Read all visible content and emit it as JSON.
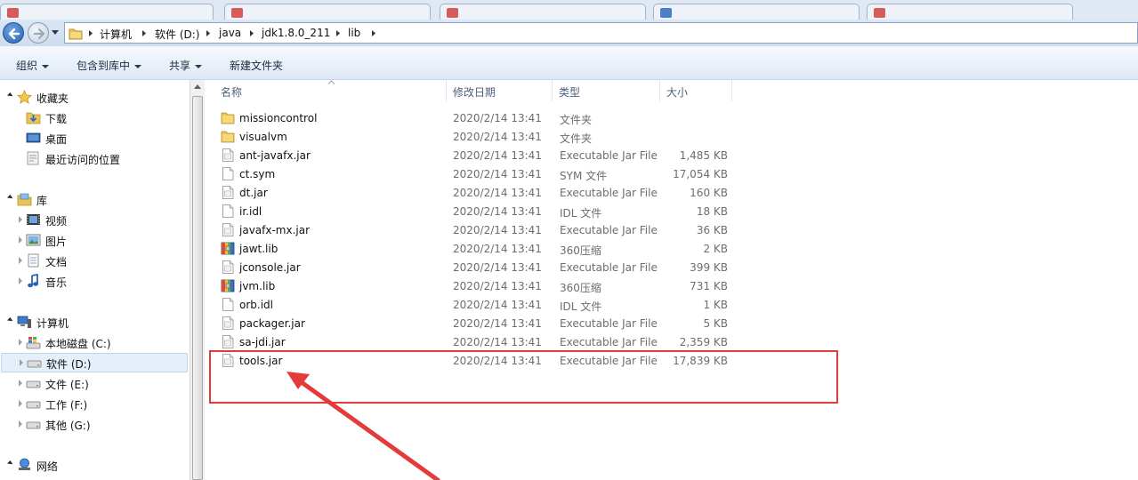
{
  "browser_tabs": [
    {
      "label": "",
      "color": "#d85b5b"
    },
    {
      "label": "",
      "color": "#d85b5b"
    },
    {
      "label": "",
      "color": "#d85b5b"
    },
    {
      "label": "",
      "color": "#4b7fc7"
    },
    {
      "label": "",
      "color": "#d85b5b"
    }
  ],
  "address_bar": {
    "breadcrumbs": [
      "计算机",
      "软件 (D:)",
      "java",
      "jdk1.8.0_211",
      "lib"
    ]
  },
  "toolbar": {
    "organize": "组织",
    "include_in_library": "包含到库中",
    "share": "共享",
    "new_folder": "新建文件夹"
  },
  "nav": {
    "favorites": {
      "label": "收藏夹",
      "items": [
        "下载",
        "桌面",
        "最近访问的位置"
      ]
    },
    "libraries": {
      "label": "库",
      "items": [
        "视频",
        "图片",
        "文档",
        "音乐"
      ]
    },
    "computer": {
      "label": "计算机",
      "items": [
        "本地磁盘 (C:)",
        "软件 (D:)",
        "文件 (E:)",
        "工作 (F:)",
        "其他 (G:)"
      ],
      "selected": "软件 (D:)"
    },
    "network": {
      "label": "网络"
    }
  },
  "columns": {
    "name": "名称",
    "date": "修改日期",
    "type": "类型",
    "size": "大小"
  },
  "files": [
    {
      "name": "missioncontrol",
      "date": "2020/2/14 13:41",
      "type": "文件夹",
      "size": "",
      "icon": "folder-icon"
    },
    {
      "name": "visualvm",
      "date": "2020/2/14 13:41",
      "type": "文件夹",
      "size": "",
      "icon": "folder-icon"
    },
    {
      "name": "ant-javafx.jar",
      "date": "2020/2/14 13:41",
      "type": "Executable Jar File",
      "size": "1,485 KB",
      "icon": "jar-file-icon"
    },
    {
      "name": "ct.sym",
      "date": "2020/2/14 13:41",
      "type": "SYM 文件",
      "size": "17,054 KB",
      "icon": "generic-file-icon"
    },
    {
      "name": "dt.jar",
      "date": "2020/2/14 13:41",
      "type": "Executable Jar File",
      "size": "160 KB",
      "icon": "jar-file-icon"
    },
    {
      "name": "ir.idl",
      "date": "2020/2/14 13:41",
      "type": "IDL 文件",
      "size": "18 KB",
      "icon": "generic-file-icon"
    },
    {
      "name": "javafx-mx.jar",
      "date": "2020/2/14 13:41",
      "type": "Executable Jar File",
      "size": "36 KB",
      "icon": "jar-file-icon"
    },
    {
      "name": "jawt.lib",
      "date": "2020/2/14 13:41",
      "type": "360压缩",
      "size": "2 KB",
      "icon": "archive-icon"
    },
    {
      "name": "jconsole.jar",
      "date": "2020/2/14 13:41",
      "type": "Executable Jar File",
      "size": "399 KB",
      "icon": "jar-file-icon"
    },
    {
      "name": "jvm.lib",
      "date": "2020/2/14 13:41",
      "type": "360压缩",
      "size": "731 KB",
      "icon": "archive-icon"
    },
    {
      "name": "orb.idl",
      "date": "2020/2/14 13:41",
      "type": "IDL 文件",
      "size": "1 KB",
      "icon": "generic-file-icon"
    },
    {
      "name": "packager.jar",
      "date": "2020/2/14 13:41",
      "type": "Executable Jar File",
      "size": "5 KB",
      "icon": "jar-file-icon"
    },
    {
      "name": "sa-jdi.jar",
      "date": "2020/2/14 13:41",
      "type": "Executable Jar File",
      "size": "2,359 KB",
      "icon": "jar-file-icon"
    },
    {
      "name": "tools.jar",
      "date": "2020/2/14 13:41",
      "type": "Executable Jar File",
      "size": "17,839 KB",
      "icon": "jar-file-icon"
    }
  ],
  "colors": {
    "annotation_red": "#e53a3a",
    "folder_yellow": "#e8c356",
    "selection_bg": "#e5eff9"
  }
}
